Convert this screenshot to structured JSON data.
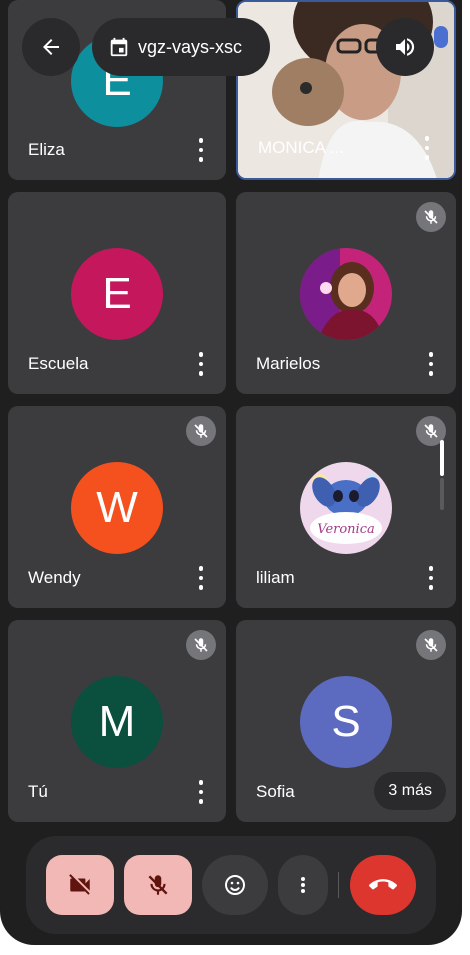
{
  "meeting": {
    "code": "vgz-vays-xsc"
  },
  "participants": [
    {
      "name": "Eliza",
      "initial": "E",
      "color": "#0e8f9e"
    },
    {
      "name": "MONICA ...",
      "video": true
    },
    {
      "name": "Escuela",
      "initial": "E",
      "color": "#c5175c"
    },
    {
      "name": "Marielos",
      "photo": true
    },
    {
      "name": "Wendy",
      "initial": "W",
      "color": "#f4511e"
    },
    {
      "name": "liliam",
      "photo": true,
      "photo_text": "Veronica"
    },
    {
      "name": "Tú",
      "initial": "M",
      "color": "#0b4f3f"
    },
    {
      "name": "Sofia",
      "initial": "S",
      "color": "#5c6bc0"
    }
  ],
  "more_participants": "3 más",
  "controls": {
    "camera_off": "video-off-icon",
    "mic_off": "mic-off-icon",
    "reactions": "emoji-icon",
    "more": "more-vert-icon",
    "leave": "hang-up-icon"
  },
  "colors": {
    "background": "#1f1f1f",
    "tile": "#3c3c3e",
    "pink_button": "#f2b8b5",
    "hangup": "#dc362e"
  }
}
